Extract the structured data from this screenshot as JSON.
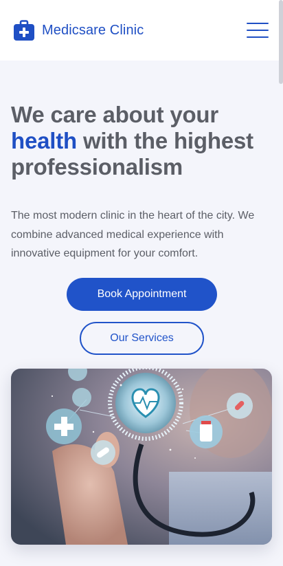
{
  "header": {
    "brand_name": "Medicsare Clinic",
    "brand_icon": "medical-kit-icon",
    "menu_icon": "hamburger-menu-icon"
  },
  "hero": {
    "title_before": "We care about your ",
    "title_accent": "health",
    "title_after": " with the highest professionalism",
    "description": "The most modern clinic in the heart of the city. We combine advanced medical experience with innovative equipment for your comfort.",
    "primary_button": "Book Appointment",
    "secondary_button": "Our Services",
    "image_subject": "doctor-stethoscope-heart-illustration"
  },
  "colors": {
    "brand": "#1f4fc4",
    "button": "#2053c9",
    "background": "#f4f5fb",
    "text": "#5b5e66"
  }
}
